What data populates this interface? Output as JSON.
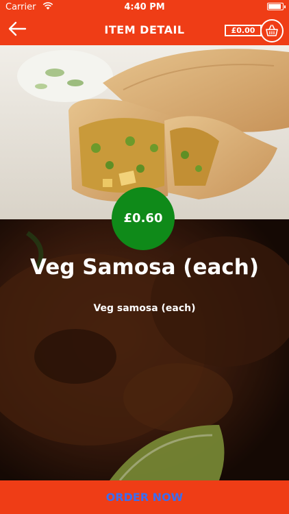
{
  "status_bar": {
    "carrier": "Carrier",
    "time": "4:40 PM",
    "battery_level": 0.9
  },
  "nav": {
    "title": "ITEM DETAIL",
    "back_icon": "back-arrow-icon",
    "cart_amount": "£0.00",
    "cart_icon": "basket-icon"
  },
  "item": {
    "price": "£0.60",
    "title": "Veg Samosa (each)",
    "description": "Veg samosa (each)"
  },
  "footer": {
    "order_label": "ORDER NOW"
  },
  "colors": {
    "brand": "#ef3d16",
    "price_badge": "#0f8a19",
    "order_text": "#3b6df0"
  }
}
